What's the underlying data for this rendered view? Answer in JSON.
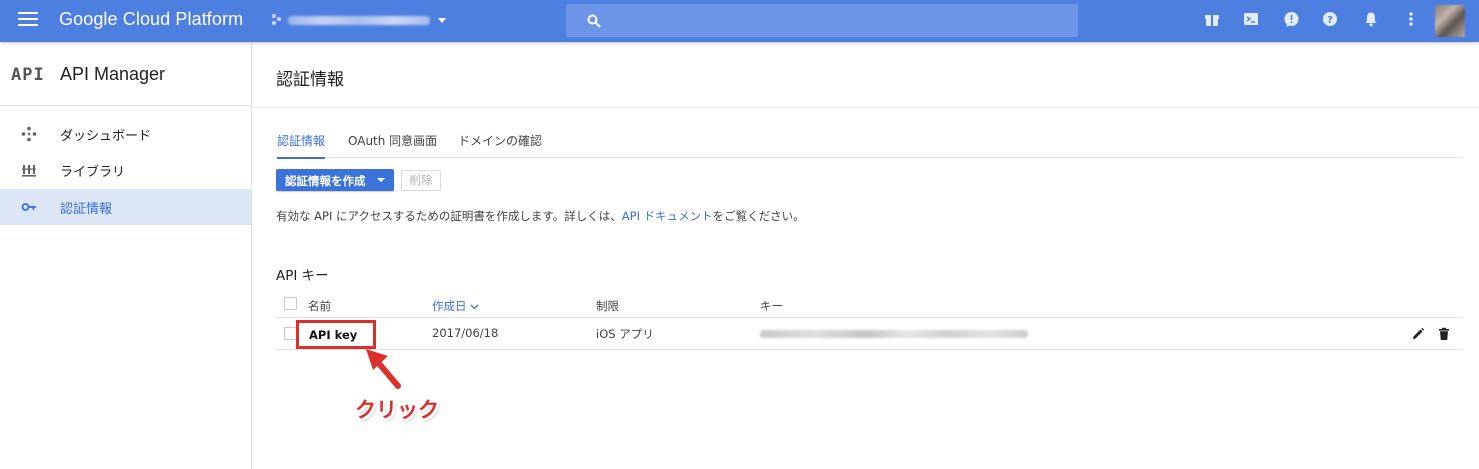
{
  "topbar": {
    "brand": "Google Cloud Platform",
    "project": "",
    "icons": [
      "menu-icon",
      "search-icon",
      "gift-icon",
      "cloud-shell-icon",
      "notifications-alert-icon",
      "help-icon",
      "bell-icon",
      "more-vert-icon",
      "account-avatar"
    ]
  },
  "sidebar": {
    "logo": "API",
    "title": "API Manager",
    "items": [
      {
        "label": "ダッシュボード",
        "icon": "dashboard-icon",
        "active": false
      },
      {
        "label": "ライブラリ",
        "icon": "library-icon",
        "active": false
      },
      {
        "label": "認証情報",
        "icon": "key-icon",
        "active": true
      }
    ]
  },
  "main": {
    "title": "認証情報",
    "tabs": [
      {
        "label": "認証情報",
        "active": true
      },
      {
        "label": "OAuth 同意画面",
        "active": false
      },
      {
        "label": "ドメインの確認",
        "active": false
      }
    ],
    "create_button": "認証情報を作成",
    "delete_button": "削除",
    "description": {
      "before": "有効な API にアクセスするための証明書を作成します。詳しくは、",
      "link": "API ドキュメント",
      "after": "をご覧ください。"
    },
    "section_title": "API キー",
    "table": {
      "columns": [
        "名前",
        "作成日",
        "制限",
        "キー"
      ],
      "sorted_column": "作成日",
      "rows": [
        {
          "name": "API key",
          "created": "2017/06/18",
          "restriction": "iOS アプリ",
          "key": ""
        }
      ]
    },
    "annotation": "クリック"
  },
  "colors": {
    "topbar": "#4d7fe0",
    "accent": "#3b6fd6",
    "active_nav_bg": "#dce6f7",
    "annotation_red": "#d9312a"
  }
}
